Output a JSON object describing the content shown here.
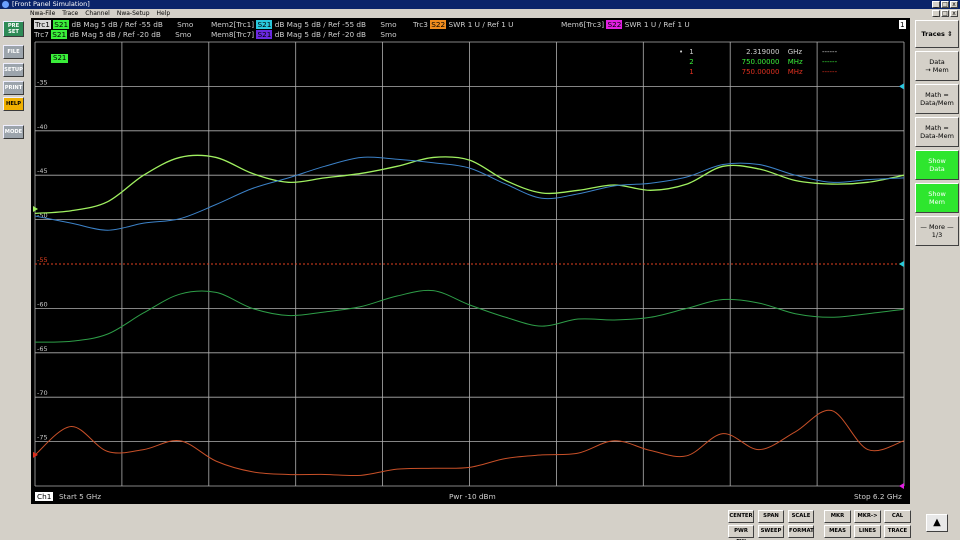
{
  "window": {
    "title": "[Front Panel Simulation]",
    "buttons": [
      "_",
      "□",
      "x"
    ]
  },
  "menu": {
    "items": [
      "Nwa-File",
      "Trace",
      "Channel",
      "Nwa-Setup",
      "Help"
    ]
  },
  "left_buttons": [
    {
      "label": "PRE SET"
    },
    {
      "label": "FILE"
    },
    {
      "label": "SETUP"
    },
    {
      "label": "PRINT"
    },
    {
      "label": "HELP"
    },
    {
      "label": "MODE"
    }
  ],
  "header": {
    "row1": [
      {
        "tag": "Trc1",
        "param": "S21",
        "info": "dB Mag  5 dB /  Ref -55 dB",
        "extra": "Smo",
        "tagColor": "#d8d8d8",
        "paramColor": "#3aee3a"
      },
      {
        "tag": "Mem2[Trc1]",
        "param": "S21",
        "info": "dB Mag  5 dB /  Ref -55 dB",
        "extra": "Smo",
        "tagColor": "",
        "paramColor": "#2ac8dc"
      },
      {
        "tag": "Trc3",
        "param": "S22",
        "info": "SWR  1 U /  Ref 1 U",
        "extra": "",
        "tagColor": "",
        "paramColor": "#f08c1e"
      },
      {
        "tag": "Mem6[Trc3]",
        "param": "S22",
        "info": "SWR  1 U /  Ref 1 U",
        "extra": "",
        "tagColor": "",
        "paramColor": "#e020e0"
      }
    ],
    "row2": [
      {
        "tag": "Trc7",
        "param": "S21",
        "info": "dB Mag  5 dB /  Ref -20 dB",
        "extra": "Smo",
        "paramColor": "#3aee3a"
      },
      {
        "tag": "Mem8[Trc7]",
        "param": "S21",
        "info": "dB Mag  5 dB /  Ref -20 dB",
        "extra": "Smo",
        "paramColor": "#6a2ae0"
      }
    ],
    "badge": "1"
  },
  "active_label": "S21",
  "markers": [
    {
      "bullet": "•",
      "num": "1",
      "value": "2.319000",
      "unit": "GHz",
      "result": "------",
      "color": "#cfcfcf"
    },
    {
      "bullet": "",
      "num": "2",
      "value": "750.00000",
      "unit": "MHz",
      "result": "------",
      "color": "#3aee3a"
    },
    {
      "bullet": "",
      "num": "1",
      "value": "750.00000",
      "unit": "MHz",
      "result": "------",
      "color": "#e03020"
    }
  ],
  "footer": {
    "channel": "Ch1",
    "start": "Start  5 GHz",
    "power": "Pwr  -10 dBm",
    "stop": "Stop  6.2 GHz"
  },
  "softkeys": [
    {
      "label": "Traces ⇕",
      "on": false
    },
    {
      "label": "Data\n→ Mem",
      "on": false
    },
    {
      "label": "Math =\nData/Mem",
      "on": false
    },
    {
      "label": "Math =\nData-Mem",
      "on": false
    },
    {
      "label": "Show\nData",
      "on": true
    },
    {
      "label": "Show\nMem",
      "on": true
    },
    {
      "label": "— More —\n1/3",
      "on": false
    }
  ],
  "hardkeys": [
    {
      "label": "CENTER"
    },
    {
      "label": "SPAN"
    },
    {
      "label": "SCALE"
    },
    {
      "label": "PWR BW"
    },
    {
      "label": "SWEEP"
    },
    {
      "label": "FORMAT"
    },
    {
      "label": "MKR"
    },
    {
      "label": "MKR->"
    },
    {
      "label": "CAL"
    },
    {
      "label": "MEAS"
    },
    {
      "label": "LINES"
    },
    {
      "label": "TRACE"
    }
  ],
  "up_button": "▲",
  "chart_data": {
    "type": "line",
    "x": [
      5.0,
      5.05,
      5.1,
      5.15,
      5.2,
      5.25,
      5.3,
      5.35,
      5.4,
      5.45,
      5.5,
      5.55,
      5.6,
      5.65,
      5.7,
      5.75,
      5.8,
      5.85,
      5.9,
      5.95,
      6.0,
      6.05,
      6.1,
      6.15,
      6.2
    ],
    "xlabel": "",
    "ylim": [
      -80,
      -30
    ],
    "yticks": [
      -35,
      -40,
      -45,
      -50,
      -55,
      -60,
      -65,
      -70,
      -75
    ],
    "reference_line": -55,
    "series": [
      {
        "name": "Trc1 S21",
        "color": "#a0f060",
        "values": [
          -49.3,
          -49.0,
          -48.0,
          -45.0,
          -43.0,
          -43.0,
          -44.8,
          -45.8,
          -45.3,
          -44.8,
          -44.0,
          -43.0,
          -43.3,
          -45.6,
          -47.0,
          -46.7,
          -46.1,
          -46.7,
          -46.0,
          -44.0,
          -44.3,
          -45.6,
          -46.0,
          -45.8,
          -45.0
        ]
      },
      {
        "name": "Mem2[Trc1] S21",
        "color": "#3c82c8",
        "values": [
          -49.6,
          -50.4,
          -51.2,
          -50.4,
          -49.9,
          -48.3,
          -46.5,
          -45.3,
          -44.0,
          -43.0,
          -43.2,
          -43.6,
          -44.2,
          -46.0,
          -47.6,
          -47.1,
          -46.2,
          -45.9,
          -45.2,
          -43.8,
          -43.8,
          -45.0,
          -45.8,
          -45.5,
          -45.3
        ]
      },
      {
        "name": "Trc7 S21",
        "color": "#2e9e48",
        "values": [
          -63.8,
          -63.7,
          -62.9,
          -60.5,
          -58.4,
          -58.2,
          -60.0,
          -60.8,
          -60.4,
          -59.8,
          -58.6,
          -58.0,
          -59.6,
          -61.0,
          -62.0,
          -61.2,
          -61.3,
          -61.0,
          -60.0,
          -59.0,
          -59.4,
          -60.6,
          -61.0,
          -60.6,
          -60.1
        ]
      },
      {
        "name": "Trc3 S22",
        "color": "#c85028",
        "values": [
          -76.5,
          -73.3,
          -76.1,
          -75.9,
          -74.9,
          -77.2,
          -78.4,
          -78.7,
          -78.7,
          -78.8,
          -78.1,
          -78.0,
          -77.9,
          -76.9,
          -76.5,
          -76.3,
          -74.9,
          -76.0,
          -76.6,
          -74.1,
          -75.9,
          -73.9,
          -71.5,
          -75.9,
          -74.9
        ]
      }
    ]
  }
}
